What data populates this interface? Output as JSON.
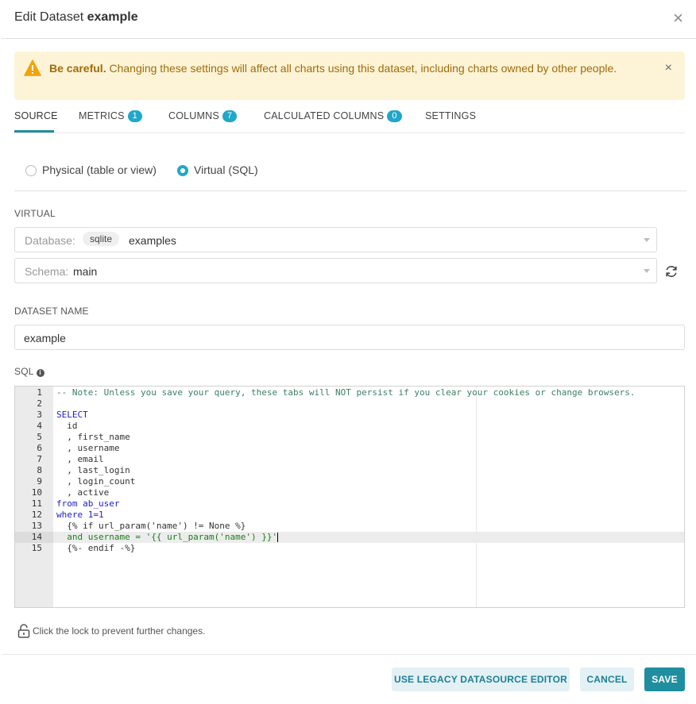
{
  "header": {
    "title_prefix": "Edit Dataset",
    "dataset_name": "example",
    "close_glyph": "×"
  },
  "alert": {
    "strong": "Be careful.",
    "message": "Changing these settings will affect all charts using this dataset, including charts owned by other people.",
    "close_glyph": "×",
    "icon": "warning-icon"
  },
  "tabs": [
    {
      "label": "SOURCE",
      "active": true
    },
    {
      "label": "METRICS",
      "badge": "1"
    },
    {
      "label": "COLUMNS",
      "badge": "7"
    },
    {
      "label": "CALCULATED COLUMNS",
      "badge": "0"
    },
    {
      "label": "SETTINGS"
    }
  ],
  "source_type": {
    "physical_label": "Physical (table or view)",
    "virtual_label": "Virtual (SQL)",
    "selected": "virtual"
  },
  "virtual": {
    "section_label": "VIRTUAL",
    "database_prefix": "Database:",
    "database_backend": "sqlite",
    "database_name": "examples",
    "schema_prefix": "Schema:",
    "schema_value": "main"
  },
  "dataset_name_field": {
    "label": "DATASET NAME",
    "value": "example"
  },
  "sql": {
    "label": "SQL",
    "info_glyph": "i",
    "lines": [
      "-- Note: Unless you save your query, these tabs will NOT persist if you clear your cookies or change browsers.",
      "",
      "SELECT",
      "  id",
      "  , first_name",
      "  , username",
      "  , email",
      "  , last_login",
      "  , login_count",
      "  , active",
      "from ab_user",
      "where 1=1",
      "  {% if url_param('name') != None %}",
      "  and username = '{{ url_param('name') }}'",
      "  {%- endif -%}"
    ],
    "line_numbers": [
      "1",
      "2",
      "3",
      "4",
      "5",
      "6",
      "7",
      "8",
      "9",
      "10",
      "11",
      "12",
      "13",
      "14",
      "15"
    ],
    "active_line": 14
  },
  "lock_text": "Click the lock to prevent further changes.",
  "footer": {
    "legacy_label": "USE LEGACY DATASOURCE EDITOR",
    "cancel_label": "CANCEL",
    "save_label": "SAVE"
  },
  "colors": {
    "accent": "#1f8ea0",
    "badge": "#20a7c9",
    "alert_bg": "#fdf4d7",
    "alert_text": "#a16b09"
  }
}
